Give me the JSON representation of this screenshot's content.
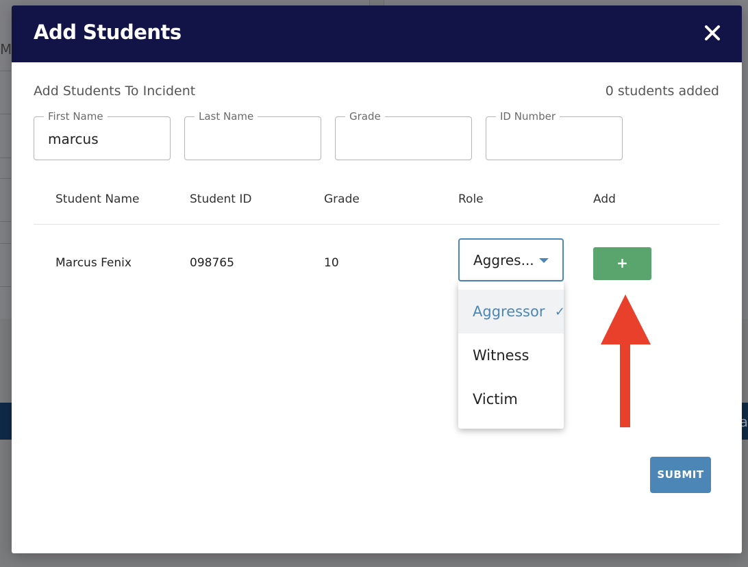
{
  "modal": {
    "title": "Add Students",
    "section_title": "Add Students To Incident",
    "students_added": "0 students added"
  },
  "search_fields": [
    {
      "label": "First Name",
      "value": "marcus"
    },
    {
      "label": "Last Name",
      "value": ""
    },
    {
      "label": "Grade",
      "value": ""
    },
    {
      "label": "ID Number",
      "value": ""
    }
  ],
  "table": {
    "headers": [
      "Student Name",
      "Student ID",
      "Grade",
      "Role",
      "Add"
    ],
    "rows": [
      {
        "name": "Marcus Fenix",
        "id": "098765",
        "grade": "10",
        "role": "Aggres..."
      }
    ]
  },
  "role_dropdown": {
    "options": [
      "Aggressor",
      "Witness",
      "Victim"
    ],
    "selected": "Aggressor",
    "check_icon": "✓"
  },
  "buttons": {
    "add_label": "+",
    "submit_label": "SUBMIT"
  },
  "background": {
    "partial_letter": "M",
    "partial_text": "ta"
  },
  "colors": {
    "header": "#121447",
    "accent": "#4b86b7",
    "add_button": "#5aa46e",
    "annotation_arrow": "#e8402a"
  },
  "icons": {
    "close": "close-icon",
    "arrow": "arrow-up-icon"
  }
}
